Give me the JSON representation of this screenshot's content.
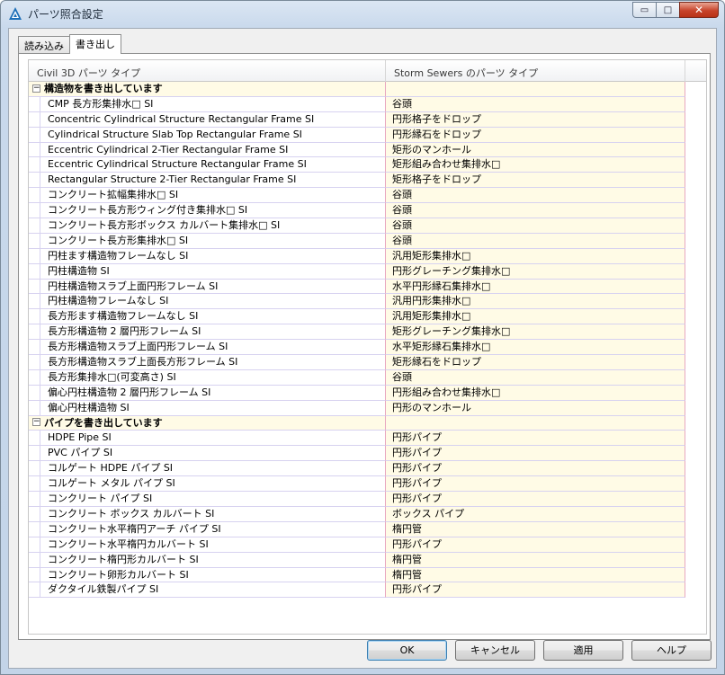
{
  "window": {
    "title": "パーツ照合設定",
    "controls": {
      "minimize": "▭",
      "maximize": "□",
      "close": "✕"
    }
  },
  "tabs": [
    {
      "label": "読み込み",
      "active": false
    },
    {
      "label": "書き出し",
      "active": true
    }
  ],
  "table": {
    "headers": [
      "Civil 3D パーツ タイプ",
      "Storm Sewers のパーツ タイプ"
    ],
    "groups": [
      {
        "label": "構造物を書き出しています",
        "toggle": "−",
        "rows": [
          [
            "CMP 長方形集排水□ SI",
            "谷頭"
          ],
          [
            "Concentric Cylindrical Structure Rectangular Frame SI",
            "円形格子をドロップ"
          ],
          [
            "Cylindrical Structure Slab Top Rectangular Frame SI",
            "円形縁石をドロップ"
          ],
          [
            "Eccentric Cylindrical 2-Tier Rectangular Frame SI",
            "矩形のマンホール"
          ],
          [
            "Eccentric Cylindrical Structure Rectangular Frame SI",
            "矩形組み合わせ集排水□"
          ],
          [
            "Rectangular Structure 2-Tier Rectangular Frame SI",
            "矩形格子をドロップ"
          ],
          [
            "コンクリート拡幅集排水□ SI",
            "谷頭"
          ],
          [
            "コンクリート長方形ウィング付き集排水□ SI",
            "谷頭"
          ],
          [
            "コンクリート長方形ボックス カルバート集排水□ SI",
            "谷頭"
          ],
          [
            "コンクリート長方形集排水□ SI",
            "谷頭"
          ],
          [
            "円柱ます構造物フレームなし SI",
            "汎用矩形集排水□"
          ],
          [
            "円柱構造物 SI",
            "円形グレーチング集排水□"
          ],
          [
            "円柱構造物スラブ上面円形フレーム SI",
            "水平円形縁石集排水□"
          ],
          [
            "円柱構造物フレームなし SI",
            "汎用円形集排水□"
          ],
          [
            "長方形ます構造物フレームなし SI",
            "汎用矩形集排水□"
          ],
          [
            "長方形構造物 2 層円形フレーム SI",
            "矩形グレーチング集排水□"
          ],
          [
            "長方形構造物スラブ上面円形フレーム SI",
            "水平矩形縁石集排水□"
          ],
          [
            "長方形構造物スラブ上面長方形フレーム SI",
            "矩形縁石をドロップ"
          ],
          [
            "長方形集排水□(可変高さ) SI",
            "谷頭"
          ],
          [
            "偏心円柱構造物 2 層円形フレーム SI",
            "円形組み合わせ集排水□"
          ],
          [
            "偏心円柱構造物 SI",
            "円形のマンホール"
          ]
        ]
      },
      {
        "label": "パイプを書き出しています",
        "toggle": "−",
        "rows": [
          [
            "HDPE Pipe SI",
            "円形パイプ"
          ],
          [
            "PVC パイプ SI",
            "円形パイプ"
          ],
          [
            "コルゲート HDPE パイプ SI",
            "円形パイプ"
          ],
          [
            "コルゲート メタル パイプ SI",
            "円形パイプ"
          ],
          [
            "コンクリート パイプ SI",
            "円形パイプ"
          ],
          [
            "コンクリート ボックス カルバート SI",
            "ボックス パイプ"
          ],
          [
            "コンクリート水平楕円アーチ パイプ SI",
            "楕円管"
          ],
          [
            "コンクリート水平楕円カルバート SI",
            "円形パイプ"
          ],
          [
            "コンクリート楕円形カルバート SI",
            "楕円管"
          ],
          [
            "コンクリート卵形カルバート SI",
            "楕円管"
          ],
          [
            "ダクタイル鉄製パイプ SI",
            "円形パイプ"
          ]
        ]
      }
    ]
  },
  "buttons": {
    "ok": "OK",
    "cancel": "キャンセル",
    "apply": "適用",
    "help": "ヘルプ"
  }
}
